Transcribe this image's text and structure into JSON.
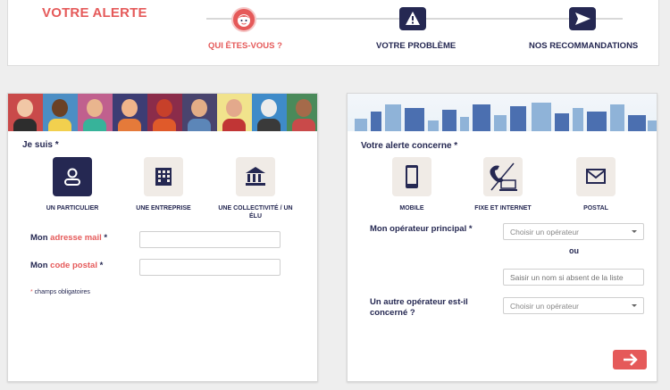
{
  "header": {
    "brand": "VOTRE ALERTE",
    "steps": [
      {
        "label": "QUI ÊTES-VOUS ?",
        "icon": "face-icon",
        "active": true
      },
      {
        "label": "VOTRE PROBLÈME",
        "icon": "warning-icon",
        "active": false
      },
      {
        "label": "NOS RECOMMANDATIONS",
        "icon": "send-icon",
        "active": false
      }
    ],
    "accent": "#e55a5a",
    "navy": "#252852"
  },
  "left": {
    "title": "Je suis *",
    "options": [
      {
        "label": "UN PARTICULIER",
        "icon": "person-icon",
        "selected": true
      },
      {
        "label": "UNE ENTREPRISE",
        "icon": "building-icon",
        "selected": false
      },
      {
        "label": "UNE COLLECTIVITÉ / UN ÉLU",
        "icon": "institution-icon",
        "selected": false
      }
    ],
    "email_label_pre": "Mon ",
    "email_label_hl": "adresse mail",
    "email_label_post": " *",
    "email_value": "",
    "postal_label_pre": "Mon ",
    "postal_label_hl": "code postal",
    "postal_label_post": " *",
    "postal_value": "",
    "note_star": "*",
    "note_text": " champs obligatoires"
  },
  "right": {
    "title": "Votre alerte concerne *",
    "options": [
      {
        "label": "MOBILE",
        "icon": "mobile-icon"
      },
      {
        "label": "FIXE ET INTERNET",
        "icon": "phone-laptop-icon"
      },
      {
        "label": "POSTAL",
        "icon": "mail-icon"
      }
    ],
    "operator_label": "Mon opérateur principal *",
    "operator_placeholder": "Choisir un opérateur",
    "or_text": "ou",
    "operator_free_placeholder": "Saisir un nom si absent de la liste",
    "other_label_line1": "Un autre opérateur est-il",
    "other_label_line2": "concerné ?",
    "other_placeholder": "Choisir un opérateur",
    "next_icon": "arrow-right-icon"
  }
}
